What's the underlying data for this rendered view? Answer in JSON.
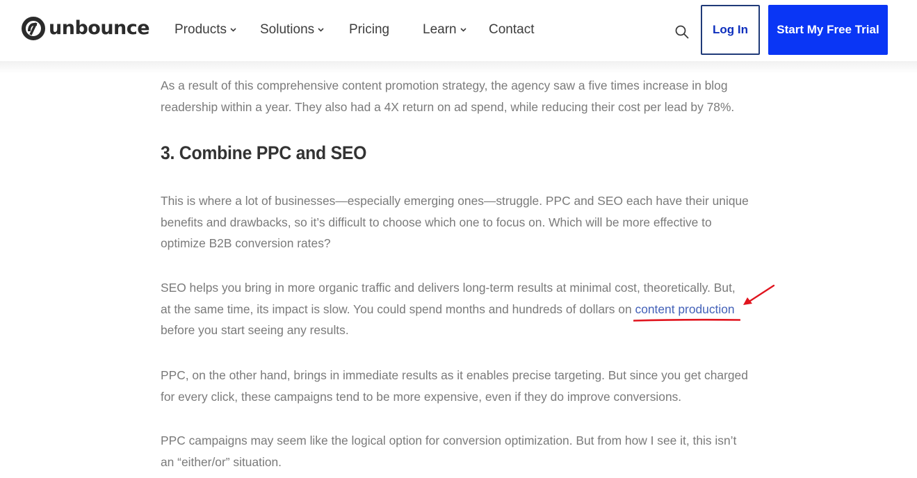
{
  "header": {
    "brand": "unbounce",
    "nav": [
      {
        "label": "Products",
        "has_dropdown": true
      },
      {
        "label": "Solutions",
        "has_dropdown": true
      },
      {
        "label": "Pricing",
        "has_dropdown": false
      },
      {
        "label": "Learn",
        "has_dropdown": true
      },
      {
        "label": "Contact",
        "has_dropdown": false
      }
    ],
    "search_icon": "search-icon",
    "login_label": "Log In",
    "trial_label": "Start My Free Trial",
    "colors": {
      "primary": "#0a36f5",
      "login_text": "#0d2fbd",
      "login_border": "#1f3a78"
    }
  },
  "article": {
    "intro": {
      "lines": [
        "As a result of this comprehensive content promotion strategy, the agency saw a five times increase in blog",
        "readership within a year. They also had a 4X return on ad spend, while reducing their cost per lead by 78%."
      ]
    },
    "heading": "3. Combine PPC and SEO",
    "p1": {
      "lines": [
        "This is where a lot of businesses—especially emerging ones—struggle. PPC and SEO each have their unique",
        "benefits and drawbacks, so it’s difficult to choose which one to focus on. Which will be more effective to",
        "optimize B2B conversion rates?"
      ]
    },
    "p2": {
      "line1": "SEO helps you bring in more organic traffic and delivers long-term results at minimal cost, theoretically. But,",
      "line2_before": "at the same time, its impact is slow. You could spend months and hundreds of dollars on ",
      "link_text": "content production",
      "line3": "before you start seeing any results."
    },
    "p3": {
      "lines": [
        "PPC, on the other hand, brings in immediate results as it enables precise targeting. But since you get charged",
        "for every click, these campaigns tend to be more expensive, even if they do improve conversions."
      ]
    },
    "p4": {
      "lines": [
        "PPC campaigns may seem like the logical option for conversion optimization. But from how I see it, this isn’t",
        "an “either/or” situation."
      ]
    },
    "colors": {
      "text": "#7a7a7a",
      "link": "#4361b8",
      "annotation": "#e0141e"
    }
  }
}
